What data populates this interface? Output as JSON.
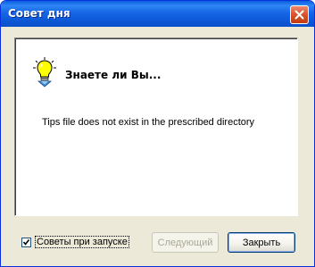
{
  "window": {
    "title": "Совет дня"
  },
  "tip": {
    "heading": "Знаете ли Вы...",
    "text": "Tips file does not exist in the prescribed directory"
  },
  "startup_option": {
    "label": "Советы при запуске",
    "checked": true
  },
  "buttons": {
    "next_label": "Следующий",
    "close_label": "Закрыть"
  },
  "icons": {
    "tip": "lightbulb-icon",
    "titlebar_close": "close-icon",
    "check": "checkmark-icon"
  },
  "colors": {
    "titlebar": "#0a5ee0",
    "close_button": "#d9532a",
    "window_face": "#ece9d8",
    "disabled_text": "#aca899"
  }
}
